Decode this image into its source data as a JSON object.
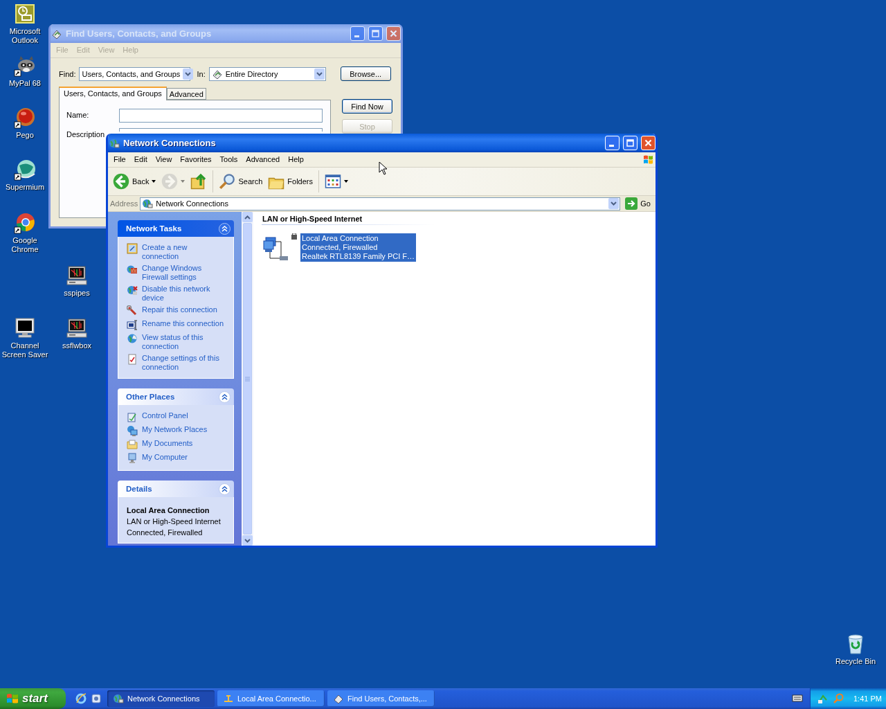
{
  "desktop_icons": [
    {
      "label": "Microsoft Outlook"
    },
    {
      "label": "MyPal 68"
    },
    {
      "label": "Pego"
    },
    {
      "label": "Supermium"
    },
    {
      "label": "Google Chrome"
    },
    {
      "label": "sspipes"
    },
    {
      "label": "Channel Screen Saver"
    },
    {
      "label": "ssflwbox"
    },
    {
      "label": "Recycle Bin"
    }
  ],
  "find_window": {
    "title": "Find Users, Contacts, and Groups",
    "active": false,
    "menu": [
      "File",
      "Edit",
      "View",
      "Help"
    ],
    "find_label": "Find:",
    "find_value": "Users, Contacts, and Groups",
    "in_label": "In:",
    "in_value": "Entire Directory",
    "browse": "Browse...",
    "tabs": [
      {
        "label": "Users, Contacts, and Groups",
        "selected": true
      },
      {
        "label": "Advanced",
        "selected": false
      }
    ],
    "fields": [
      {
        "label": "Name:"
      },
      {
        "label": "Description"
      }
    ],
    "buttons": [
      {
        "label": "Find Now",
        "disabled": false
      },
      {
        "label": "Stop",
        "disabled": true
      }
    ]
  },
  "network_window": {
    "title": "Network Connections",
    "active": true,
    "menu": [
      "File",
      "Edit",
      "View",
      "Favorites",
      "Tools",
      "Advanced",
      "Help"
    ],
    "toolbar": [
      {
        "kind": "back",
        "label": "Back",
        "disabled": false
      },
      {
        "kind": "forward",
        "disabled": true
      },
      {
        "kind": "up",
        "disabled": false
      },
      {
        "kind": "search",
        "label": "Search",
        "disabled": false
      },
      {
        "kind": "folders",
        "label": "Folders",
        "disabled": false
      },
      {
        "kind": "views",
        "disabled": false
      }
    ],
    "address_label": "Address",
    "address_value": "Network Connections",
    "go": "Go",
    "panels": [
      {
        "title": "Network Tasks",
        "kind": "special",
        "expanded": true,
        "items": [
          "Create a new connection",
          "Change Windows Firewall settings",
          "Disable this network device",
          "Repair this connection",
          "Rename this connection",
          "View status of this connection",
          "Change settings of this connection"
        ]
      },
      {
        "title": "Other Places",
        "kind": "normal",
        "expanded": true,
        "items": [
          "Control Panel",
          "My Network Places",
          "My Documents",
          "My Computer"
        ]
      },
      {
        "title": "Details",
        "kind": "normal",
        "expanded": true,
        "heading": "Local Area Connection",
        "lines": [
          "LAN or High-Speed Internet",
          "Connected, Firewalled"
        ]
      }
    ],
    "group_heading": "LAN or High-Speed Internet",
    "connections": [
      {
        "lines": [
          "Local Area Connection",
          "Connected, Firewalled",
          "Realtek RTL8139 Family PCI F…"
        ],
        "selected": true
      }
    ]
  },
  "taskbar": {
    "start": "start",
    "tasks": [
      {
        "label": "Network Connections",
        "selected": true
      },
      {
        "label": "Local Area Connectio...",
        "selected": false
      },
      {
        "label": "Find Users, Contacts,...",
        "selected": false
      }
    ],
    "clock": "1:41 PM"
  }
}
